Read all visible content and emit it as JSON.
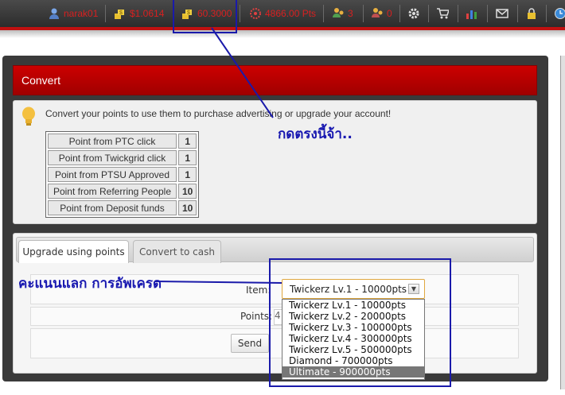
{
  "topbar": {
    "username": "narak01",
    "balance_1": "$1.0614",
    "balance_2": "60.3000",
    "points": "4866.00 Pts",
    "referrals": "3",
    "rented": "0"
  },
  "panel": {
    "title": "Convert",
    "info_text": "Convert your points to use them to purchase advertising or upgrade your account!",
    "points_table": [
      {
        "label": "Point from PTC click",
        "value": "1"
      },
      {
        "label": "Point from Twickgrid click",
        "value": "1"
      },
      {
        "label": "Point from PTSU Approved",
        "value": "1"
      },
      {
        "label": "Point from Referring People",
        "value": "10"
      },
      {
        "label": "Point from Deposit funds",
        "value": "10"
      }
    ]
  },
  "tabs": [
    {
      "label": "Upgrade using points"
    },
    {
      "label": "Convert to cash"
    }
  ],
  "form": {
    "item_label": "Item:",
    "item_selected": "Twickerz Lv.1 - 10000pts",
    "points_label": "Points:",
    "points_value": "4",
    "send_label": "Send",
    "options": [
      "Twickerz Lv.1 - 10000pts",
      "Twickerz Lv.2 - 20000pts",
      "Twickerz Lv.3 - 100000pts",
      "Twickerz Lv.4 - 300000pts",
      "Twickerz Lv.5 - 500000pts",
      "Diamond - 700000pts",
      "Ultimate - 900000pts"
    ],
    "highlighted_option_index": 6
  },
  "annotations": {
    "click_here": "กดตรงนี้จ้า..",
    "exchange_points": "คะแนนแลก การอัพเครด"
  },
  "colors": {
    "accent_red": "#c00000",
    "annotation_blue": "#1a1aaa",
    "topbar_text": "#d82020"
  }
}
